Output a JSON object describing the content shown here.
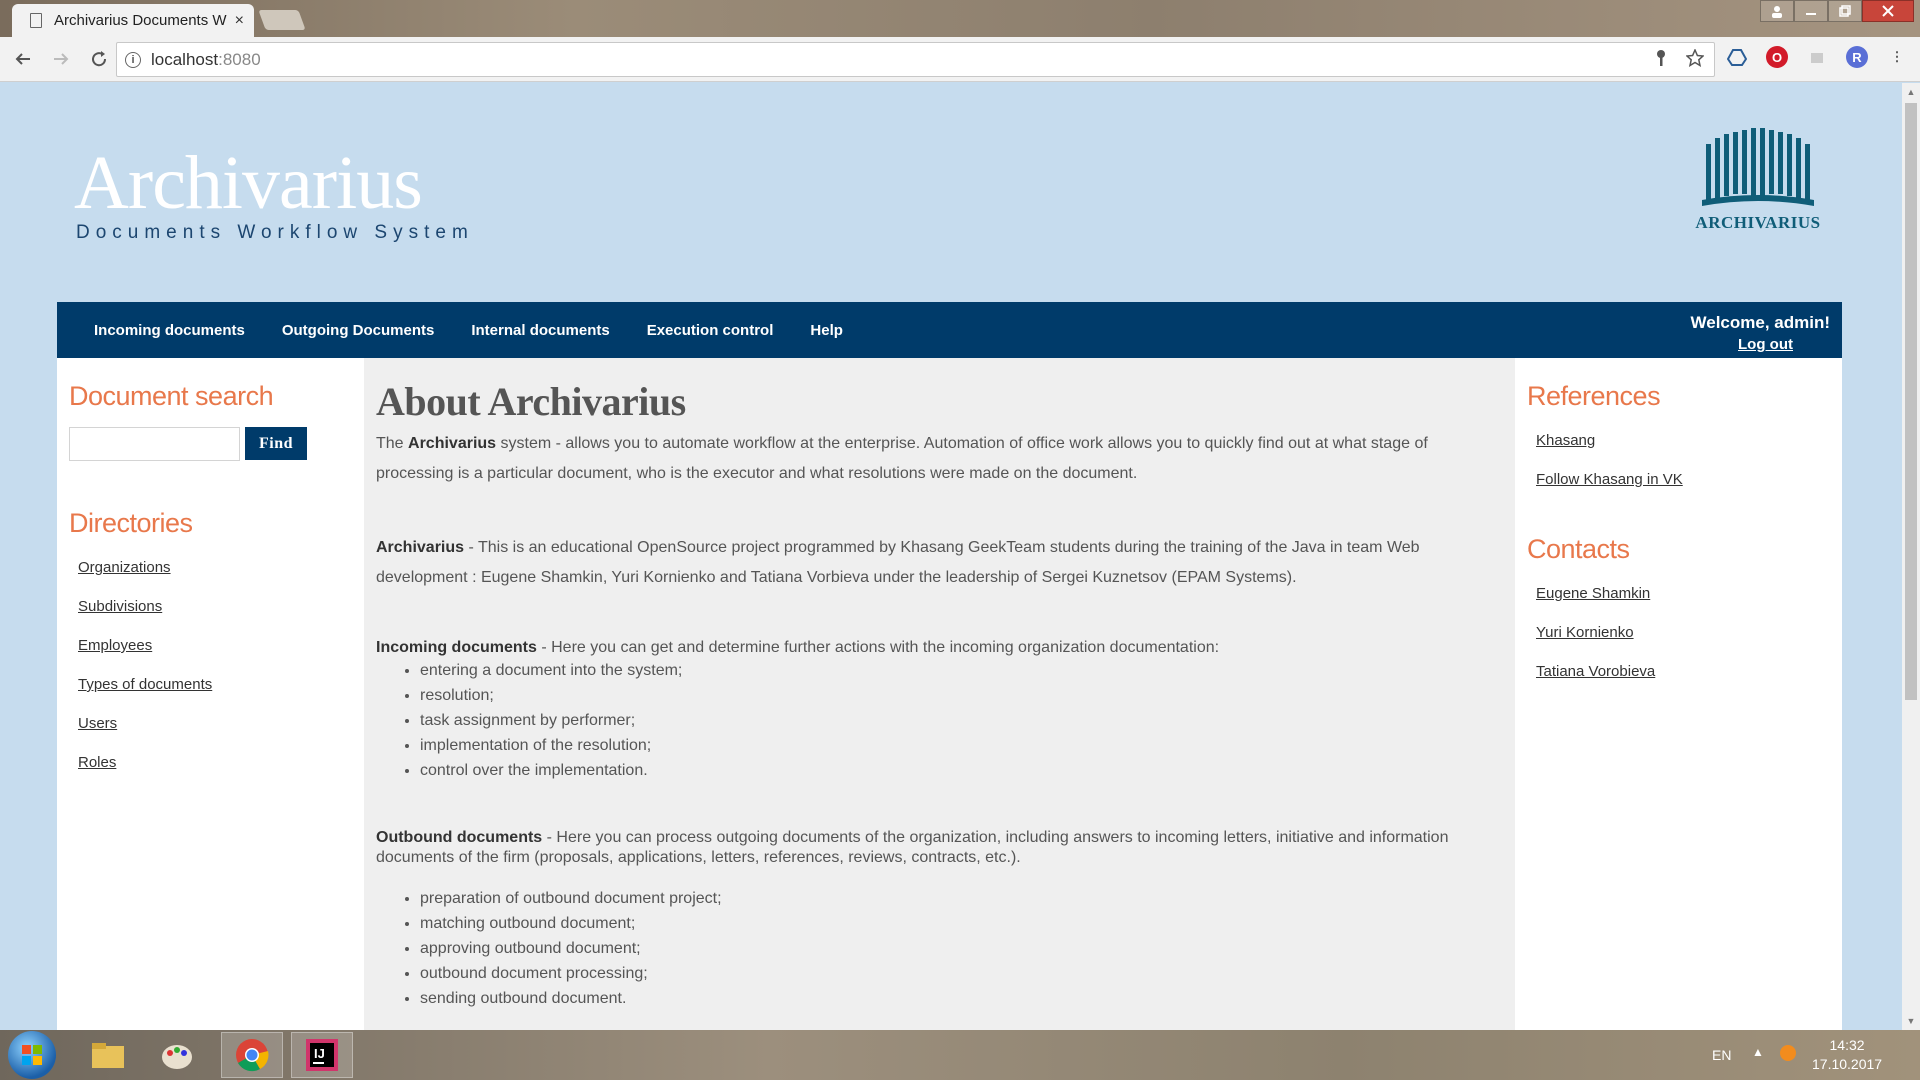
{
  "browser": {
    "tab_title": "Archivarius Documents W",
    "tab_close": "×",
    "url_host": "localhost",
    "url_port": ":8080",
    "window_buttons": [
      "minimize",
      "restore",
      "close"
    ]
  },
  "header": {
    "site_title": "Archivarius",
    "site_subtitle": "Documents Workflow System",
    "logo_text": "ARCHIVARIUS"
  },
  "nav": {
    "items": [
      "Incoming documents",
      "Outgoing Documents",
      "Internal documents",
      "Execution control",
      "Help"
    ],
    "welcome": "Welcome, admin!",
    "logout": "Log out"
  },
  "left": {
    "search_heading": "Document search",
    "search_value": "",
    "find_label": "Find",
    "directories_heading": "Directories",
    "directories": [
      "Organizations",
      "Subdivisions",
      "Employees",
      "Types of documents",
      "Users",
      "Roles"
    ]
  },
  "main": {
    "heading": "About Archivarius",
    "p1_pre": "The ",
    "p1_bold": "Archivarius",
    "p1_text": " system - allows you to automate workflow at the enterprise. Automation of office work allows you to quickly find out at what stage of processing is a particular document, who is the executor and what resolutions were made on the document.",
    "p2_bold": "Archivarius",
    "p2_text": " - This is an educational OpenSource project programmed by Khasang GeekTeam students during the training of the Java in team Web development : Eugene Shamkin, Yuri Kornienko and Tatiana Vorbieva under the leadership of Sergei Kuznetsov (EPAM Systems).",
    "incoming_bold": "Incoming documents",
    "incoming_text": " - Here you can get and determine further actions with the incoming organization documentation:",
    "incoming_items": [
      "entering a document into the system;",
      "resolution;",
      "task assignment by performer;",
      "implementation of the resolution;",
      "control over the implementation."
    ],
    "outbound_bold": "Outbound documents",
    "outbound_text": " - Here you can process outgoing documents of the organization, including answers to incoming letters, initiative and information documents of the firm (proposals, applications, letters, references, reviews, contracts, etc.).",
    "outbound_items": [
      "preparation of outbound document project;",
      "matching outbound document;",
      "approving outbound document;",
      "outbound document processing;",
      "sending outbound document."
    ]
  },
  "right": {
    "references_heading": "References",
    "references": [
      "Khasang",
      "Follow Khasang in VK"
    ],
    "contacts_heading": "Contacts",
    "contacts": [
      "Eugene Shamkin",
      "Yuri Kornienko",
      "Tatiana Vorobieva"
    ]
  },
  "taskbar": {
    "lang": "EN",
    "time": "14:32",
    "date": "17.10.2017"
  }
}
